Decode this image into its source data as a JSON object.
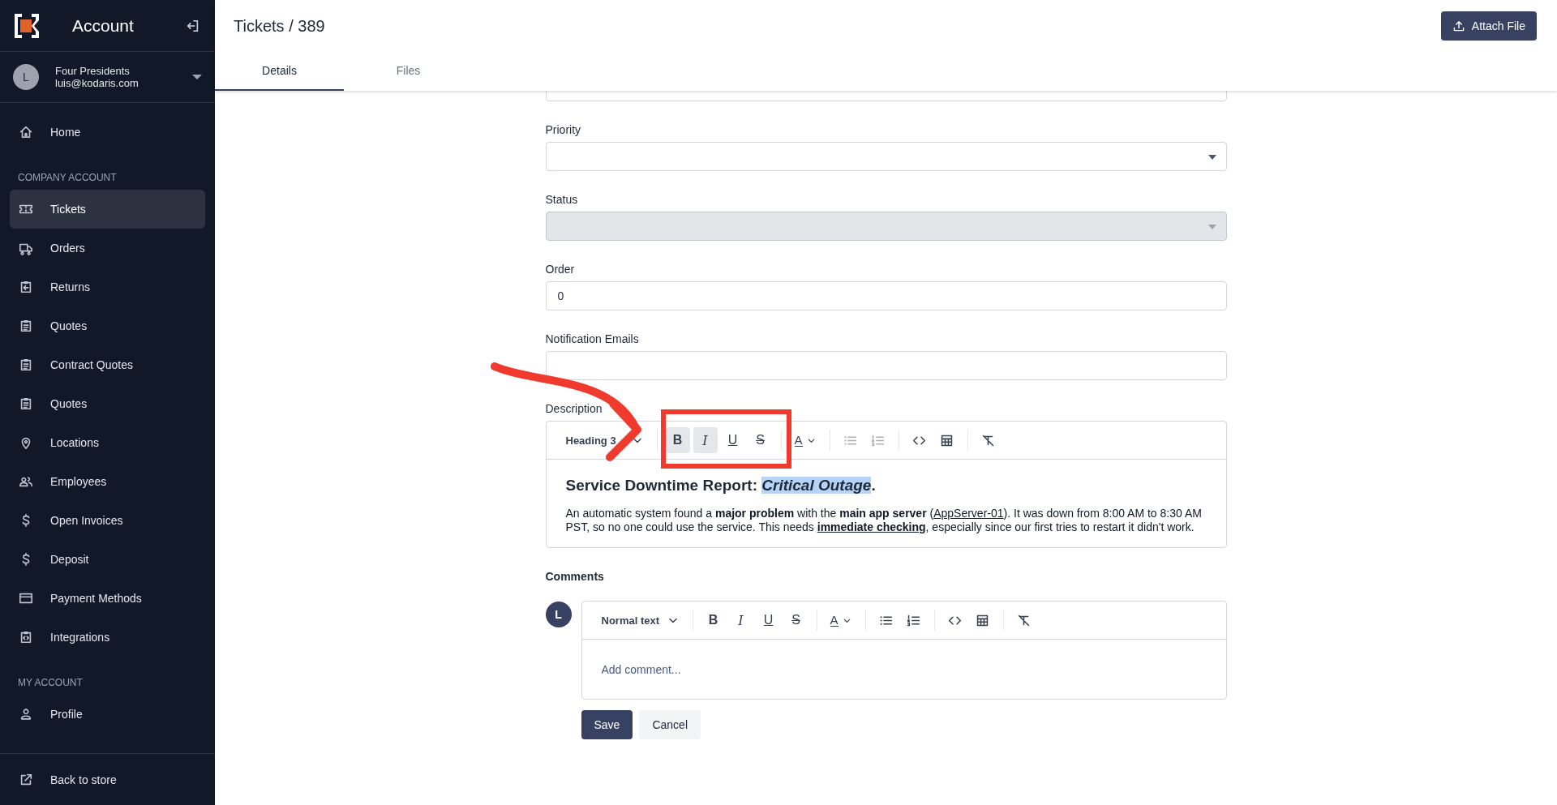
{
  "sidebar": {
    "brand": "Account",
    "user": {
      "initial": "L",
      "name": "Four Presidents",
      "email": "luis@kodaris.com"
    },
    "sections": [
      {
        "items": [
          {
            "label": "Home",
            "selected": false
          }
        ]
      },
      {
        "title": "COMPANY ACCOUNT",
        "items": [
          {
            "label": "Tickets",
            "selected": true
          },
          {
            "label": "Orders",
            "selected": false
          },
          {
            "label": "Returns",
            "selected": false
          },
          {
            "label": "Quotes",
            "selected": false
          },
          {
            "label": "Contract Quotes",
            "selected": false
          },
          {
            "label": "Quotes",
            "selected": false
          },
          {
            "label": "Locations",
            "selected": false
          },
          {
            "label": "Employees",
            "selected": false
          },
          {
            "label": "Open Invoices",
            "selected": false
          },
          {
            "label": "Deposit",
            "selected": false
          },
          {
            "label": "Payment Methods",
            "selected": false
          },
          {
            "label": "Integrations",
            "selected": false
          }
        ]
      },
      {
        "title": "MY ACCOUNT",
        "items": [
          {
            "label": "Profile",
            "selected": false
          }
        ]
      }
    ],
    "footer": "Back to store"
  },
  "header": {
    "title": "Tickets / 389",
    "button": "Attach File"
  },
  "tabs": [
    {
      "label": "Details",
      "selected": true
    },
    {
      "label": "Files",
      "selected": false
    }
  ],
  "fields": [
    {
      "kind": "text",
      "disabled": false
    },
    {
      "kind": "select",
      "label": "Priority",
      "disabled": false
    },
    {
      "kind": "select",
      "label": "Status",
      "disabled": true
    },
    {
      "kind": "text",
      "label": "Order",
      "value": "0",
      "disabled": false
    },
    {
      "kind": "text",
      "label": "Notification Emails",
      "disabled": false
    }
  ],
  "description": {
    "label": "Description",
    "toolbar": {
      "block_style": "Heading 3",
      "tools": [
        {
          "kind": "bold",
          "label": "B",
          "active": true,
          "disabled": false
        },
        {
          "kind": "italic",
          "label": "I",
          "active": true,
          "disabled": false
        },
        {
          "kind": "underline",
          "label": "U",
          "active": false,
          "disabled": false
        },
        {
          "kind": "strike",
          "label": "S",
          "active": false,
          "disabled": false
        },
        {
          "kind": "color",
          "label": "A",
          "active": false,
          "disabled": false
        },
        {
          "kind": "bullets",
          "active": false,
          "disabled": true
        },
        {
          "kind": "numbered",
          "active": false,
          "disabled": true
        },
        {
          "kind": "code",
          "active": false,
          "disabled": false
        },
        {
          "kind": "table",
          "active": false,
          "disabled": false
        },
        {
          "kind": "clear",
          "active": false,
          "disabled": false
        }
      ]
    },
    "heading": [
      {
        "text": "Service Downtime Report: ",
        "selected": false
      },
      {
        "text": "Critical Outage",
        "selected": true,
        "italic": true
      },
      {
        "text": ".",
        "selected": false
      }
    ],
    "paragraph": [
      {
        "text": "An automatic system found a "
      },
      {
        "text": "major problem",
        "bold": true
      },
      {
        "text": " with the "
      },
      {
        "text": "main app server",
        "bold": true
      },
      {
        "text": " ("
      },
      {
        "text": "AppServer-01",
        "underline": true
      },
      {
        "text": "). It was down from 8:00 AM to 8:30 AM PST, so no one could use the service. This needs "
      },
      {
        "text": "immediate checking",
        "bold": true,
        "underline": true
      },
      {
        "text": ", especially since our first tries to restart it didn't work."
      }
    ]
  },
  "comments": {
    "label": "Comments",
    "avatar": "L",
    "toolbar": {
      "block_style": "Normal text",
      "tools": [
        {
          "kind": "bold",
          "label": "B",
          "active": false,
          "disabled": false
        },
        {
          "kind": "italic",
          "label": "I",
          "active": false,
          "disabled": false
        },
        {
          "kind": "underline",
          "label": "U",
          "active": false,
          "disabled": false
        },
        {
          "kind": "strike",
          "label": "S",
          "active": false,
          "disabled": false
        },
        {
          "kind": "color",
          "label": "A",
          "active": false,
          "disabled": false
        },
        {
          "kind": "bullets",
          "active": false,
          "disabled": false
        },
        {
          "kind": "numbered",
          "active": false,
          "disabled": false
        },
        {
          "kind": "code",
          "active": false,
          "disabled": false
        },
        {
          "kind": "table",
          "active": false,
          "disabled": false
        },
        {
          "kind": "clear",
          "active": false,
          "disabled": false
        }
      ]
    },
    "placeholder": "Add comment...",
    "buttons": [
      {
        "kind": "primary",
        "label": "Save"
      },
      {
        "kind": "secondary",
        "label": "Cancel"
      }
    ]
  },
  "annotations": [
    {
      "kind": "arrow"
    },
    {
      "kind": "box"
    }
  ]
}
